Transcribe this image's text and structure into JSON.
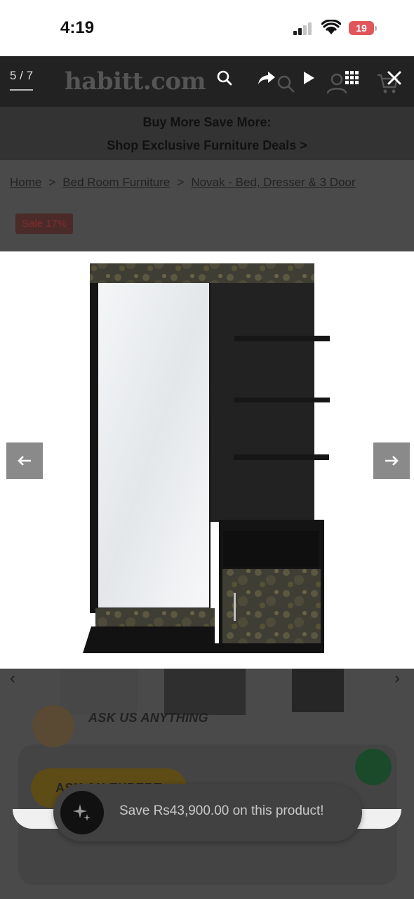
{
  "status_bar": {
    "time": "4:19",
    "battery_level": "19",
    "battery_color": "#e0565b",
    "signal_icon": "cellular-signal-icon",
    "wifi_icon": "wifi-icon"
  },
  "lightbox": {
    "counter": "5 / 7",
    "current_index": 5,
    "total": 7,
    "tools": {
      "zoom": "magnifier-icon",
      "share": "share-arrow-icon",
      "slideshow": "play-icon",
      "thumbnails": "grid-icon",
      "close": "close-icon"
    },
    "prev_icon": "arrow-left-icon",
    "next_icon": "arrow-right-icon"
  },
  "site": {
    "logo": "habitt.com",
    "promo": {
      "line1": "Buy More Save More:",
      "line2": "Shop Exclusive Furniture Deals >"
    },
    "breadcrumb": {
      "items": [
        "Home",
        "Bed Room Furniture",
        "Novak - Bed, Dresser & 3 Door"
      ],
      "separator": ">"
    },
    "sale_badge": "Sale 17%"
  },
  "ask": {
    "title": "ASK US ANYTHING",
    "button": "ASK AN EXPERT"
  },
  "toast": {
    "text": "Save Rs43,900.00 on this product!",
    "icon": "sparkle-icon"
  },
  "product_image": {
    "description_icon": "dresser-with-mirror-image",
    "top_color": "#4b4a3f",
    "body_color": "#1e1e1e"
  }
}
